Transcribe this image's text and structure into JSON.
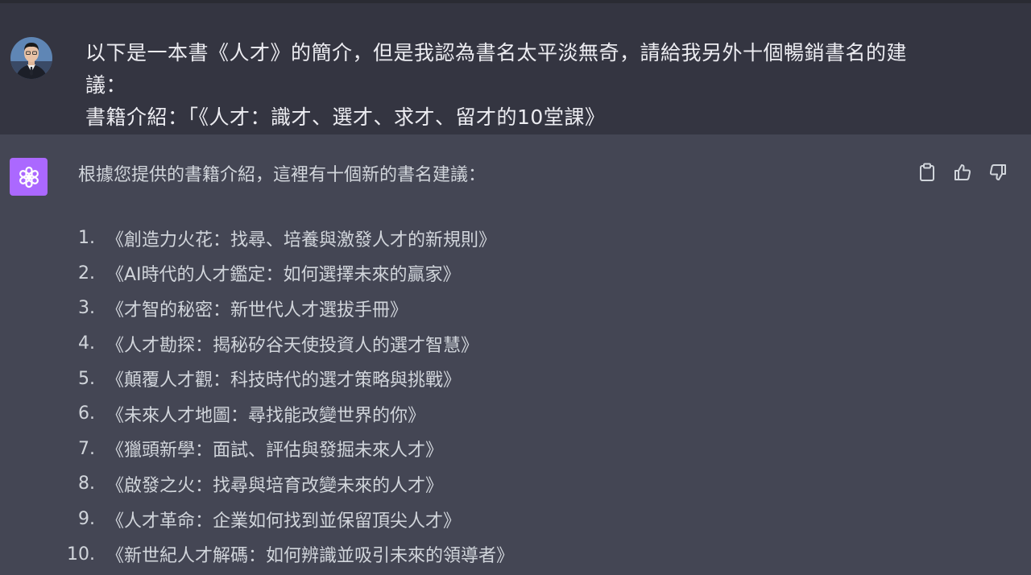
{
  "user_message": {
    "lines": [
      "以下是一本書《人才》的簡介，但是我認為書名太平淡無奇，請給我另外十個暢銷書名的建",
      "議：",
      "書籍介紹：「《人才：識才、選才、求才、留才的10堂課》"
    ]
  },
  "assistant_message": {
    "intro": "根據您提供的書籍介紹，這裡有十個新的書名建議：",
    "suggestions": [
      {
        "num": "1.",
        "title": "《創造力火花：找尋、培養與激發人才的新規則》"
      },
      {
        "num": "2.",
        "title": "《AI時代的人才鑑定：如何選擇未來的贏家》"
      },
      {
        "num": "3.",
        "title": "《才智的秘密：新世代人才選拔手冊》"
      },
      {
        "num": "4.",
        "title": "《人才勘探：揭秘矽谷天使投資人的選才智慧》"
      },
      {
        "num": "5.",
        "title": "《顛覆人才觀：科技時代的選才策略與挑戰》"
      },
      {
        "num": "6.",
        "title": "《未來人才地圖：尋找能改變世界的你》"
      },
      {
        "num": "7.",
        "title": "《獵頭新學：面試、評估與發掘未來人才》"
      },
      {
        "num": "8.",
        "title": "《啟發之火：找尋與培育改變未來的人才》"
      },
      {
        "num": "9.",
        "title": "《人才革命：企業如何找到並保留頂尖人才》"
      },
      {
        "num": "10.",
        "title": "《新世紀人才解碼：如何辨識並吸引未來的領導者》"
      }
    ]
  },
  "icons": {
    "avatar": "user-avatar",
    "assistant_logo": "openai-logo-icon",
    "copy": "clipboard-icon",
    "like": "thumbs-up-icon",
    "dislike": "thumbs-down-icon"
  },
  "colors": {
    "user_bg": "#343541",
    "assistant_bg": "#444654",
    "logo_bg": "#ab68ff",
    "text": "#d1d5db"
  }
}
